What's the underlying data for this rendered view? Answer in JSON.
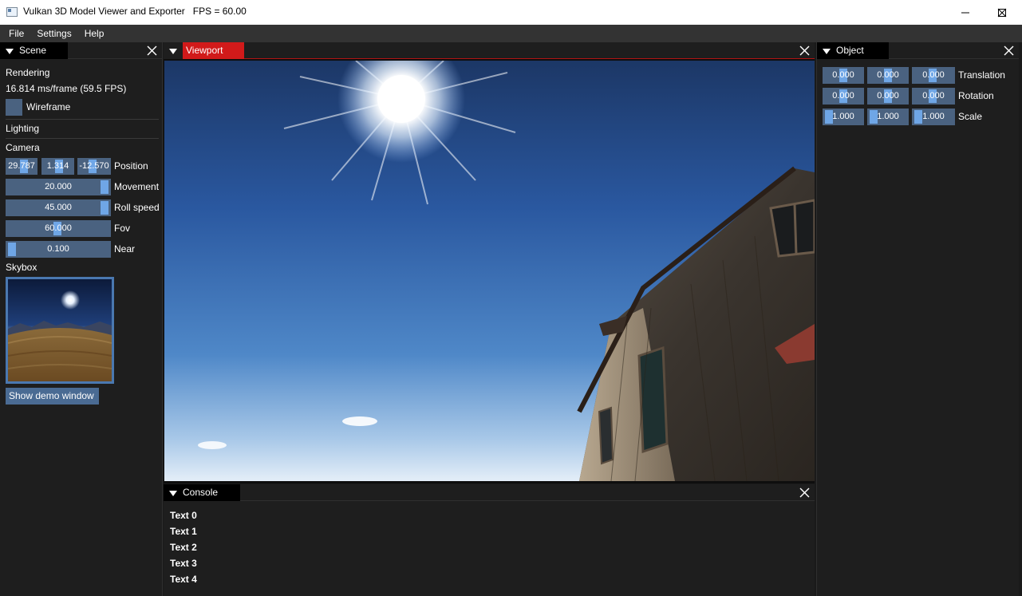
{
  "window": {
    "title": "Vulkan 3D Model Viewer and Exporter   FPS = 60.00"
  },
  "menu": [
    "File",
    "Settings",
    "Help"
  ],
  "scene": {
    "tab": "Scene",
    "rendering_heading": "Rendering",
    "frame_time": "16.814 ms/frame (59.5 FPS)",
    "wireframe_label": "Wireframe",
    "lighting_heading": "Lighting",
    "camera_heading": "Camera",
    "position": {
      "x": "29.787",
      "y": "1.314",
      "z": "-12.570",
      "label": "Position"
    },
    "movement": {
      "value": "20.000",
      "label": "Movement"
    },
    "roll_speed": {
      "value": "45.000",
      "label": "Roll speed"
    },
    "fov": {
      "value": "60.000",
      "label": "Fov"
    },
    "near": {
      "value": "0.100",
      "label": "Near"
    },
    "skybox_heading": "Skybox",
    "demo_button": "Show demo window"
  },
  "viewport": {
    "tab": "Viewport"
  },
  "console": {
    "tab": "Console",
    "lines": [
      "Text 0",
      "Text 1",
      "Text 2",
      "Text 3",
      "Text 4"
    ]
  },
  "object": {
    "tab": "Object",
    "translation": {
      "x": "0.000",
      "y": "0.000",
      "z": "0.000",
      "label": "Translation"
    },
    "rotation": {
      "x": "0.000",
      "y": "0.000",
      "z": "0.000",
      "label": "Rotation"
    },
    "scale": {
      "x": "1.000",
      "y": "1.000",
      "z": "1.000",
      "label": "Scale"
    }
  },
  "colors": {
    "active_tab": "#d11a1a",
    "slider_bg": "#4a6280",
    "slider_grab": "#6fa6e6",
    "button": "#4a6b93"
  }
}
